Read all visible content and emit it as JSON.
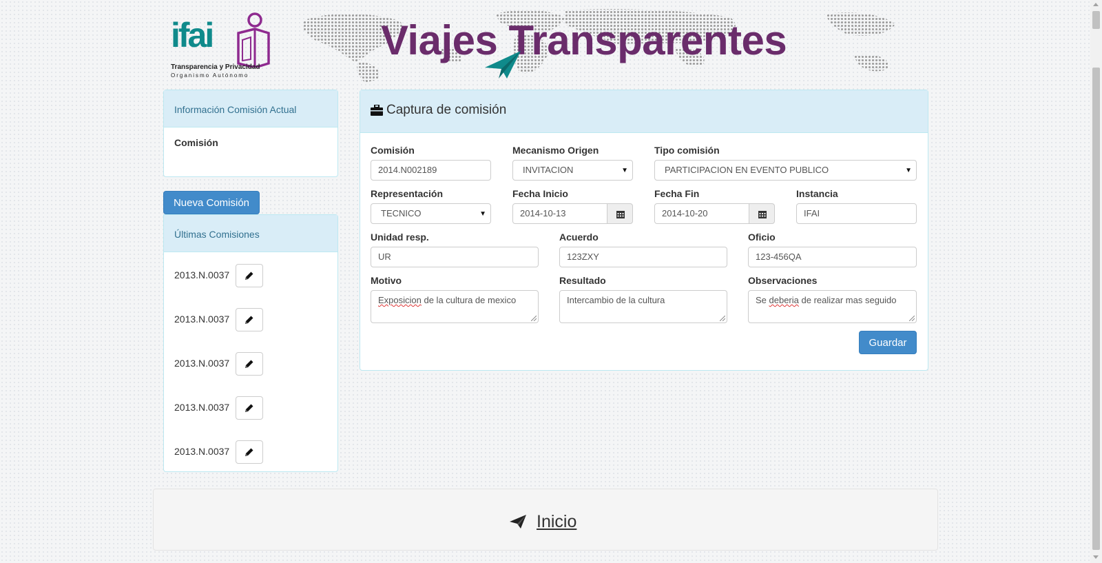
{
  "header": {
    "logo_text": "ifai",
    "logo_subtitle": "Transparencia y Privacidad",
    "logo_subtitle2": "Organismo Autónomo",
    "site_title": "Viajes Transparentes"
  },
  "sidebar": {
    "current_panel_title": "Información Comisión Actual",
    "current_label": "Comisión",
    "new_button": "Nueva Comisión",
    "recent_title": "Últimas Comisiones",
    "recent_items": [
      {
        "label": "2013.N.0037"
      },
      {
        "label": "2013.N.0037"
      },
      {
        "label": "2013.N.0037"
      },
      {
        "label": "2013.N.0037"
      },
      {
        "label": "2013.N.0037"
      }
    ]
  },
  "form": {
    "title": "Captura de comisión",
    "comision": {
      "label": "Comisión",
      "value": "2014.N002189"
    },
    "mecanismo": {
      "label": "Mecanismo Origen",
      "value": "INVITACION"
    },
    "tipo": {
      "label": "Tipo comisión",
      "value": "PARTICIPACION EN EVENTO PUBLICO"
    },
    "representacion": {
      "label": "Representación",
      "value": "TECNICO"
    },
    "fecha_inicio": {
      "label": "Fecha Inicio",
      "value": "2014-10-13"
    },
    "fecha_fin": {
      "label": "Fecha Fin",
      "value": "2014-10-20"
    },
    "instancia": {
      "label": "Instancia",
      "value": "IFAI"
    },
    "unidad": {
      "label": "Unidad resp.",
      "value": "UR"
    },
    "acuerdo": {
      "label": "Acuerdo",
      "value": "123ZXY"
    },
    "oficio": {
      "label": "Oficio",
      "value": "123-456QA"
    },
    "motivo": {
      "label": "Motivo",
      "value_w1": "Exposicion",
      "value_rest": " de la cultura de mexico"
    },
    "resultado": {
      "label": "Resultado",
      "value": "Intercambio de la cultura"
    },
    "observaciones": {
      "label": "Observaciones",
      "value_w1": "Se ",
      "value_w2": "deberia",
      "value_rest": " de realizar mas seguido"
    },
    "save_button": "Guardar"
  },
  "footer": {
    "link": "Inicio"
  },
  "colors": {
    "primary": "#428bca",
    "panel_head": "#d9edf7",
    "title": "#6a2c6b",
    "logo": "#0f8a8b"
  },
  "icons": [
    "briefcase-icon",
    "calendar-icon",
    "pencil-icon",
    "paper-plane-icon"
  ]
}
